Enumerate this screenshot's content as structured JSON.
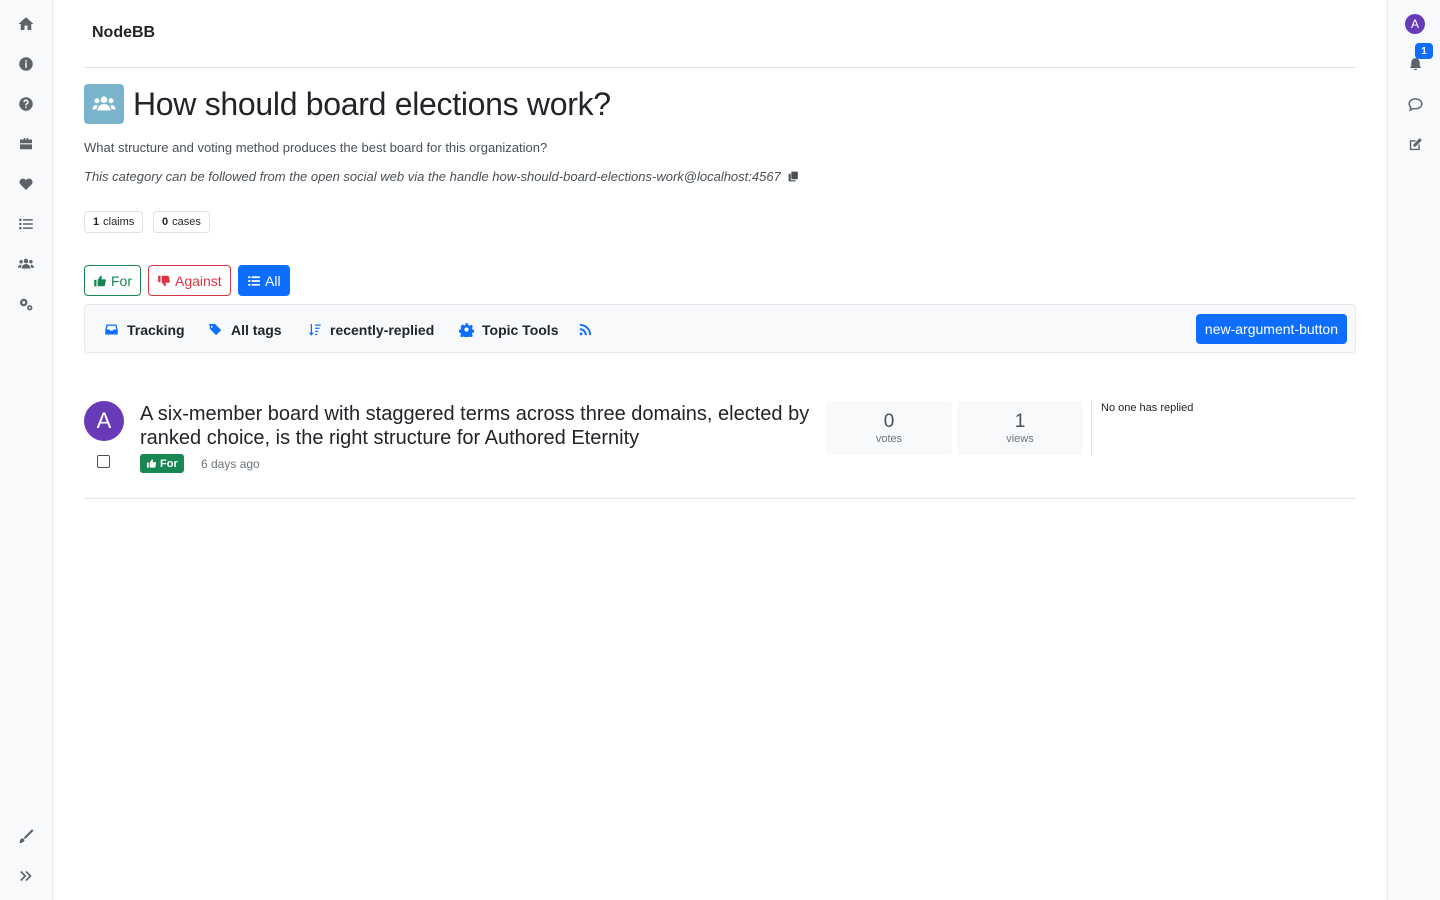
{
  "brand": "NodeBB",
  "category": {
    "title": "How should board elections work?",
    "description": "What structure and voting method produces the best board for this organization?",
    "handle_text": "This category can be followed from the open social web via the handle how-should-board-elections-work@localhost:4567",
    "icon": "users-icon",
    "icon_color": "#7ab4cc"
  },
  "stats": {
    "claims_count": "1",
    "claims_label": "claims",
    "cases_count": "0",
    "cases_label": "cases"
  },
  "filters": {
    "for_label": "For",
    "against_label": "Against",
    "all_label": "All"
  },
  "toolbar": {
    "tracking_label": "Tracking",
    "tags_label": "All tags",
    "sort_label": "recently-replied",
    "tools_label": "Topic Tools",
    "new_argument_label": "new-argument-button"
  },
  "topics": [
    {
      "avatar_letter": "A",
      "avatar_color": "#673ab7",
      "title": "A six-member board with staggered terms across three domains, elected by ranked choice, is the right structure for Authored Eternity",
      "stance_label": "For",
      "time": "6 days ago",
      "votes_count": "0",
      "votes_label": "votes",
      "views_count": "1",
      "views_label": "views",
      "last_reply": "No one has replied"
    }
  ],
  "user": {
    "avatar_letter": "A",
    "notification_count": "1"
  },
  "colors": {
    "primary": "#0d6efd",
    "success": "#198754",
    "danger": "#dc3545"
  }
}
